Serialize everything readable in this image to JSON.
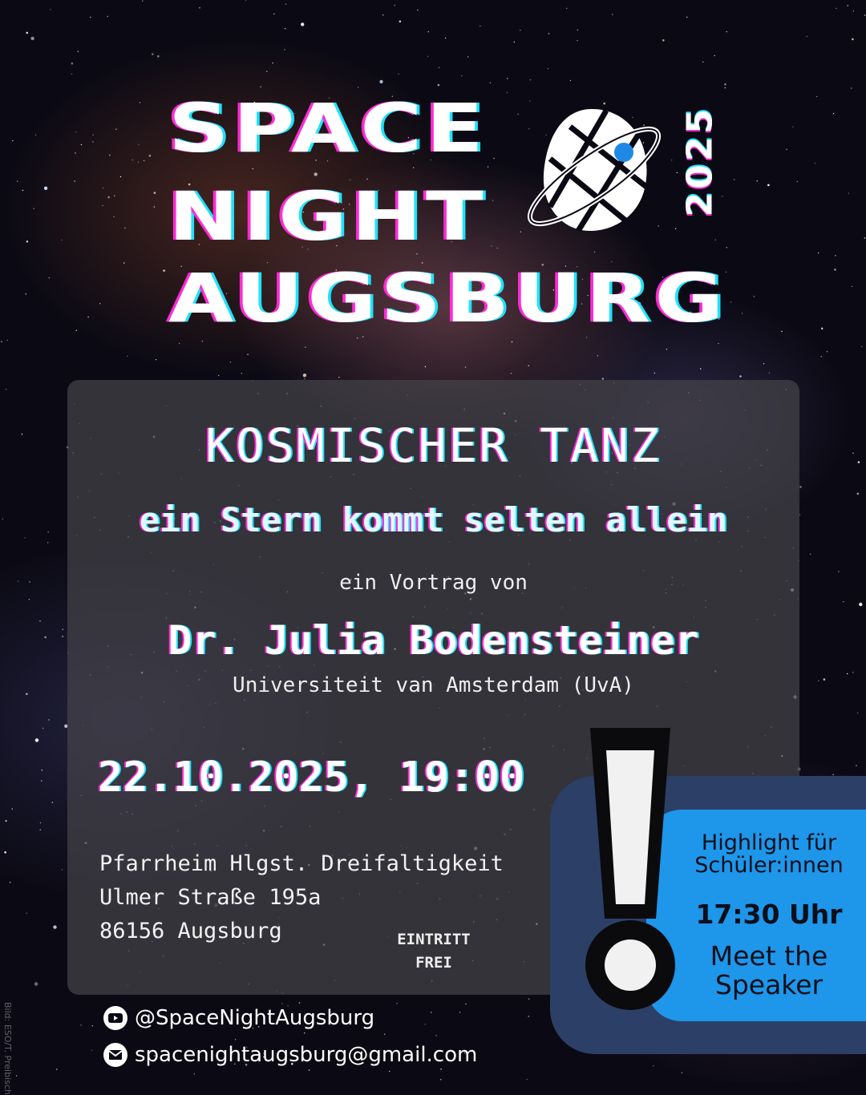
{
  "header": {
    "title_line1": "SPACE",
    "title_line2": "NIGHT",
    "title_line3": "AUGSBURG",
    "year": "2025",
    "logo_icon": "orbit-planet-logo-icon"
  },
  "talk": {
    "title": "KOSMISCHER TANZ",
    "subtitle": "ein Stern kommt selten allein",
    "byline": "ein Vortrag von",
    "speaker": "Dr. Julia Bodensteiner",
    "affiliation": "Universiteit van Amsterdam (UvA)"
  },
  "event": {
    "datetime": "22.10.2025, 19:00",
    "venue": "Pfarrheim Hlgst. Dreifaltigkeit",
    "street": "Ulmer Straße 195a",
    "city": "86156 Augsburg",
    "entry_line1": "EINTRITT",
    "entry_line2": "FREI"
  },
  "highlight": {
    "line1": "Highlight für",
    "line2": "Schüler:innen",
    "time": "17:30 Uhr",
    "line3": "Meet the",
    "line4": "Speaker",
    "icon": "exclamation-icon"
  },
  "contact": {
    "youtube": "@SpaceNightAugsburg",
    "email": "spacenightaugsburg@gmail.com"
  },
  "credit": "Bild: ESO/T. Preibisch",
  "colors": {
    "panel": "#46444a",
    "highlight_outer": "#2c3f66",
    "highlight_inner": "#1e96ea",
    "glitch_pink": "#ff2bd6",
    "glitch_cyan": "#1ee3ff",
    "logo_dot": "#1e88e5"
  }
}
